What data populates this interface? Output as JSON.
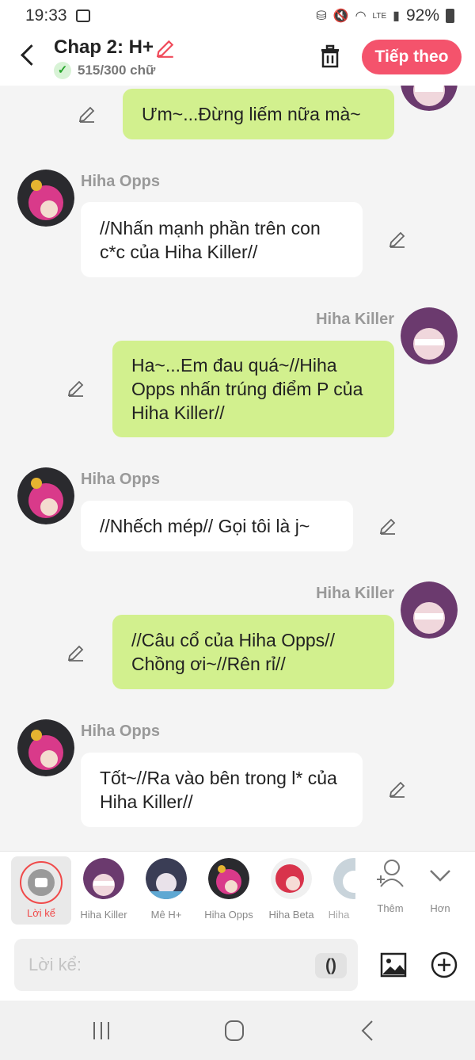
{
  "status": {
    "time": "19:33",
    "battery": "92%",
    "icons": [
      "image-icon",
      "battery-saver-icon",
      "mute-icon",
      "wifi-icon",
      "volte-icon",
      "signal-icon",
      "battery-icon"
    ]
  },
  "header": {
    "title": "Chap 2: H+",
    "word_count": "515/300 chữ",
    "next_label": "Tiếp theo"
  },
  "messages": [
    {
      "side": "me",
      "text": "Ưm~...Đừng liếm nữa mà~"
    },
    {
      "side": "other",
      "name": "Hiha Opps",
      "text": "//Nhấn mạnh phần trên con c*c của Hiha Killer//"
    },
    {
      "side": "me",
      "name": "Hiha Killer",
      "text": "Ha~...Em đau quá~//Hiha Opps nhấn trúng điểm P của Hiha Killer//"
    },
    {
      "side": "other",
      "name": "Hiha Opps",
      "text": "//Nhếch mép// Gọi tôi là j~"
    },
    {
      "side": "me",
      "name": "Hiha Killer",
      "text": "//Câu cổ của Hiha Opps// Chồng ơi~//Rên rỉ//"
    },
    {
      "side": "other",
      "name": "Hiha Opps",
      "text": "Tốt~//Ra vào bên trong l* của Hiha Killer//"
    }
  ],
  "characters": {
    "narrator": "Lời kể",
    "list": [
      "Hiha Killer",
      "Mê H+",
      "Hiha Opps",
      "Hiha Beta",
      "Hiha"
    ],
    "add": "Thêm",
    "more": "Hơn"
  },
  "input": {
    "placeholder": "Lời kể:",
    "paren": "()"
  },
  "colors": {
    "accent": "#f4536c",
    "my_bubble": "#d2f08e",
    "other_bubble": "#ffffff"
  }
}
